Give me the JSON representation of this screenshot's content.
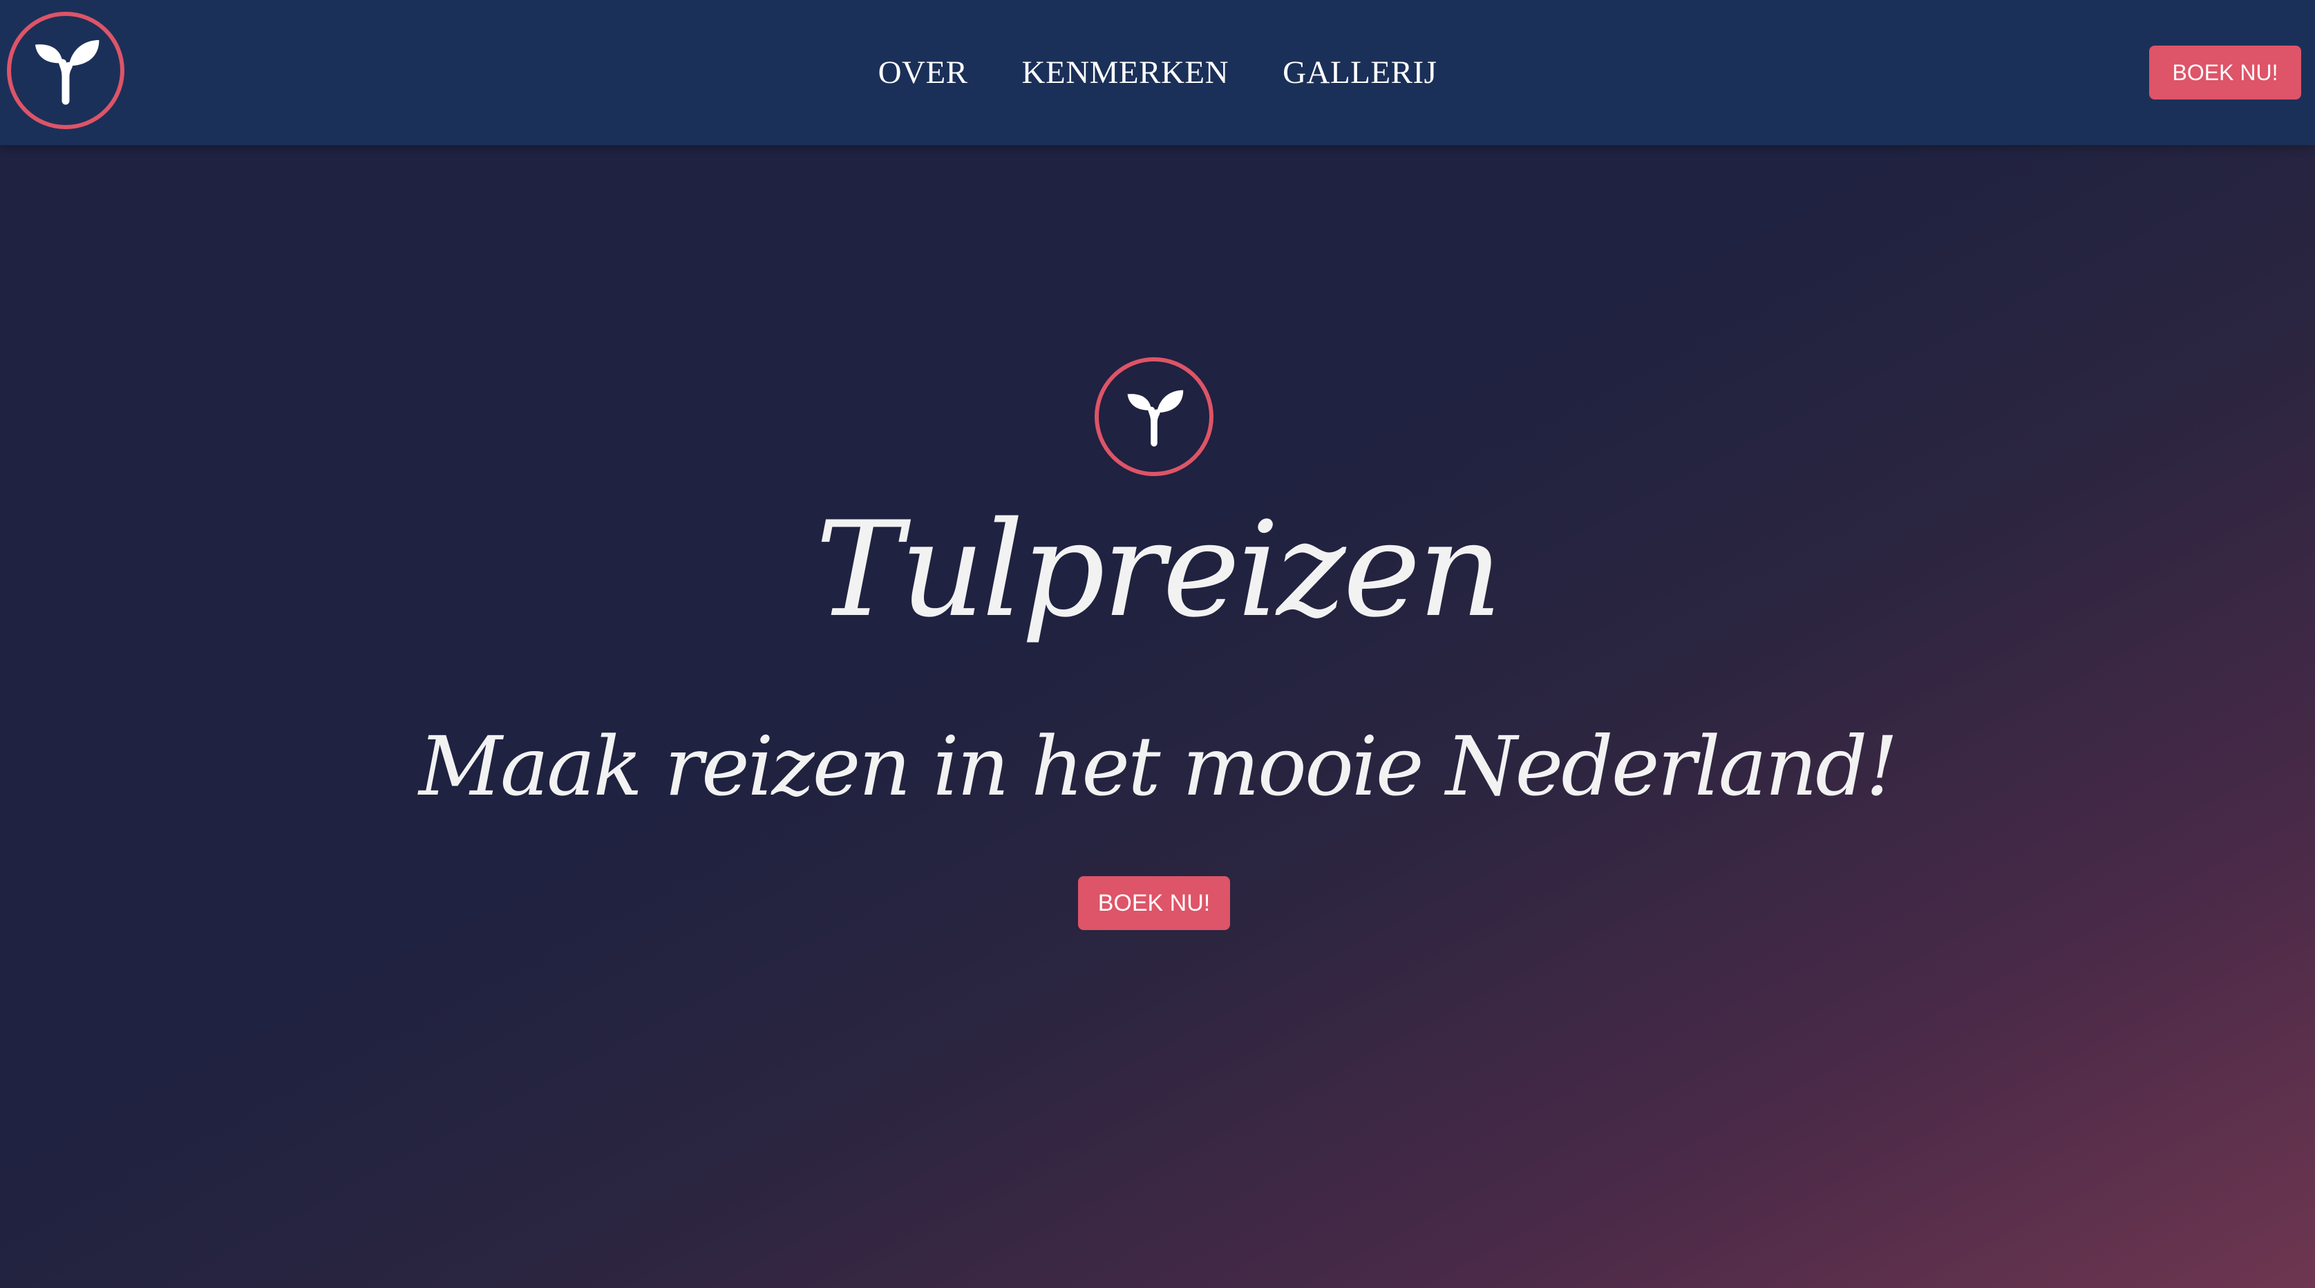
{
  "nav": {
    "links": [
      "OVER",
      "KENMERKEN",
      "GALLERIJ"
    ],
    "book_label": "BOEK NU!",
    "logo_icon": "sprout-icon"
  },
  "hero": {
    "logo_icon": "sprout-icon",
    "title": "Tulpreizen",
    "tagline": "Maak reizen in het mooie Nederland!",
    "book_label": "BOEK NU!"
  },
  "colors": {
    "navbar": "#1b3058",
    "accent": "#de5468",
    "background_start": "#1f2240",
    "background_end": "#6e3650",
    "text": "#ffffff"
  }
}
